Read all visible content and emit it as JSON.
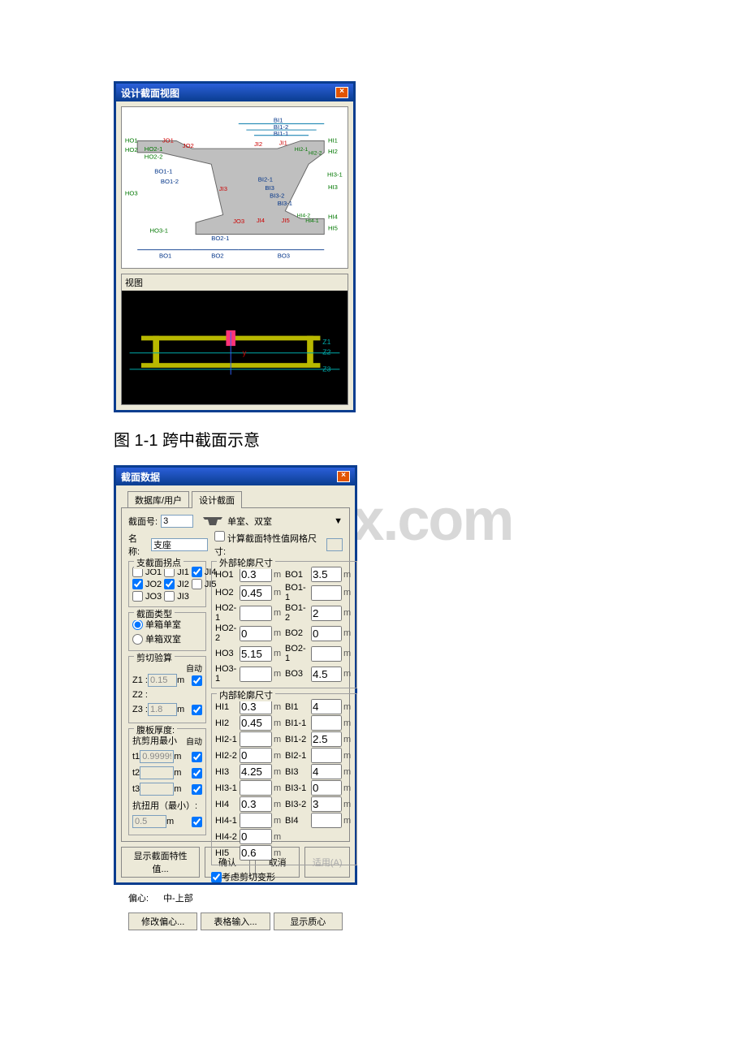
{
  "watermark": "w.bdocx.com",
  "window1": {
    "title": "设计截面视图",
    "view_label": "视图",
    "diagram_labels": {
      "BI1": "BI1",
      "BI1_2": "BI1-2",
      "BI1_1": "BI1-1",
      "HO1": "HO1",
      "JO1": "JO1",
      "JO2": "JO2",
      "JI2": "JI2",
      "JI1": "JI1",
      "HI1": "HI1",
      "HO2": "HO2",
      "HO2_1": "HO2-1",
      "HI2_1": "HI2-1",
      "HI2_2": "HI2-2",
      "HI2": "HI2",
      "HO2_2": "HO2-2",
      "BO1_1": "BO1-1",
      "BI2_1": "BI2-1",
      "HI3_1": "HI3-1",
      "BO1_2": "BO1-2",
      "BI3": "BI3",
      "HI3": "HI3",
      "HO3": "HO3",
      "JI3": "JI3",
      "BI3_2": "BI3-2",
      "BI3_1": "BI3-1",
      "JO3": "JO3",
      "JI4": "JI4",
      "JI5": "JI5",
      "HI4_2": "HI4-2",
      "HI4_1": "HI4-1",
      "HI4": "HI4",
      "HO3_1": "HO3-1",
      "HI5": "HI5",
      "BO2_1": "BO2-1",
      "BO1": "BO1",
      "BO2": "BO2",
      "BO3": "BO3",
      "Z1": "Z1",
      "Z2": "Z2",
      "Z3": "Z3",
      "y": "y"
    }
  },
  "caption": "图 1-1 跨中截面示意",
  "window2": {
    "title": "截面数据",
    "tabs": {
      "tab1": "数据库/用户",
      "tab2": "设计截面"
    },
    "section_no_label": "截面号:",
    "section_no": "3",
    "name_label": "名称:",
    "name": "支座",
    "type_dropdown": "单室、双室",
    "grid_label": "计算截面特性值网格尺寸:",
    "grid_value": "",
    "joints": {
      "legend": "支截面拐点",
      "JO1": false,
      "JI1": false,
      "JI4": true,
      "JO2": true,
      "JI2": true,
      "JI5": false,
      "JO3": false,
      "JI3": false
    },
    "sect_type": {
      "legend": "截面类型",
      "opt1": "单箱单室",
      "opt2": "单箱双室",
      "selected": "opt1"
    },
    "outer": {
      "legend": "外部轮廓尺寸",
      "HO1": "0.3",
      "BO1": "3.5",
      "HO2": "0.45",
      "BO1_1": "",
      "HO2_1": "",
      "BO1_2": "2",
      "HO2_2": "0",
      "BO2": "0",
      "HO3": "5.15",
      "BO2_1": "",
      "HO3_1": "",
      "BO3": "4.5"
    },
    "inner": {
      "legend": "内部轮廓尺寸",
      "HI1": "0.3",
      "BI1": "4",
      "HI2": "0.45",
      "BI1_1": "",
      "HI2_1": "",
      "BI1_2": "2.5",
      "HI2_2": "0",
      "BI2_1": "",
      "HI3": "4.25",
      "BI3": "4",
      "HI3_1": "",
      "BI3_1": "0",
      "HI4": "0.3",
      "BI3_2": "3",
      "HI4_1": "",
      "BI4": "",
      "HI4_2": "0",
      "HI5": "0.6"
    },
    "shear": {
      "legend": "剪切验算",
      "auto": "自动",
      "Z1_label": "Z1 :",
      "Z1": "0.15",
      "Z1_auto": true,
      "Z2_label": "Z2 :",
      "Z3_label": "Z3 :",
      "Z3": "1.8",
      "Z3_auto": true
    },
    "web": {
      "legend": "腹板厚度:",
      "min_label": "抗剪用最小",
      "auto": "自动",
      "t1_label": "t1",
      "t1": "0.99999",
      "t1_auto": true,
      "t2_label": "t2",
      "t2": "",
      "t2_auto": true,
      "t3_label": "t3",
      "t3": "",
      "t3_auto": true,
      "torsion_label": "抗扭用（最小）:",
      "torsion": "0.5",
      "torsion_auto": true
    },
    "shear_deform": "考虑剪切变形",
    "shear_deform_checked": true,
    "eccent_label": "偏心:",
    "eccent_value": "中-上部",
    "btn_modify_eccent": "修改偏心...",
    "btn_table_input": "表格输入...",
    "btn_show_centroid": "显示质心",
    "btn_show_props": "显示截面特性值...",
    "btn_ok": "确认",
    "btn_cancel": "取消",
    "btn_apply": "适用(A)"
  },
  "unit": "m"
}
